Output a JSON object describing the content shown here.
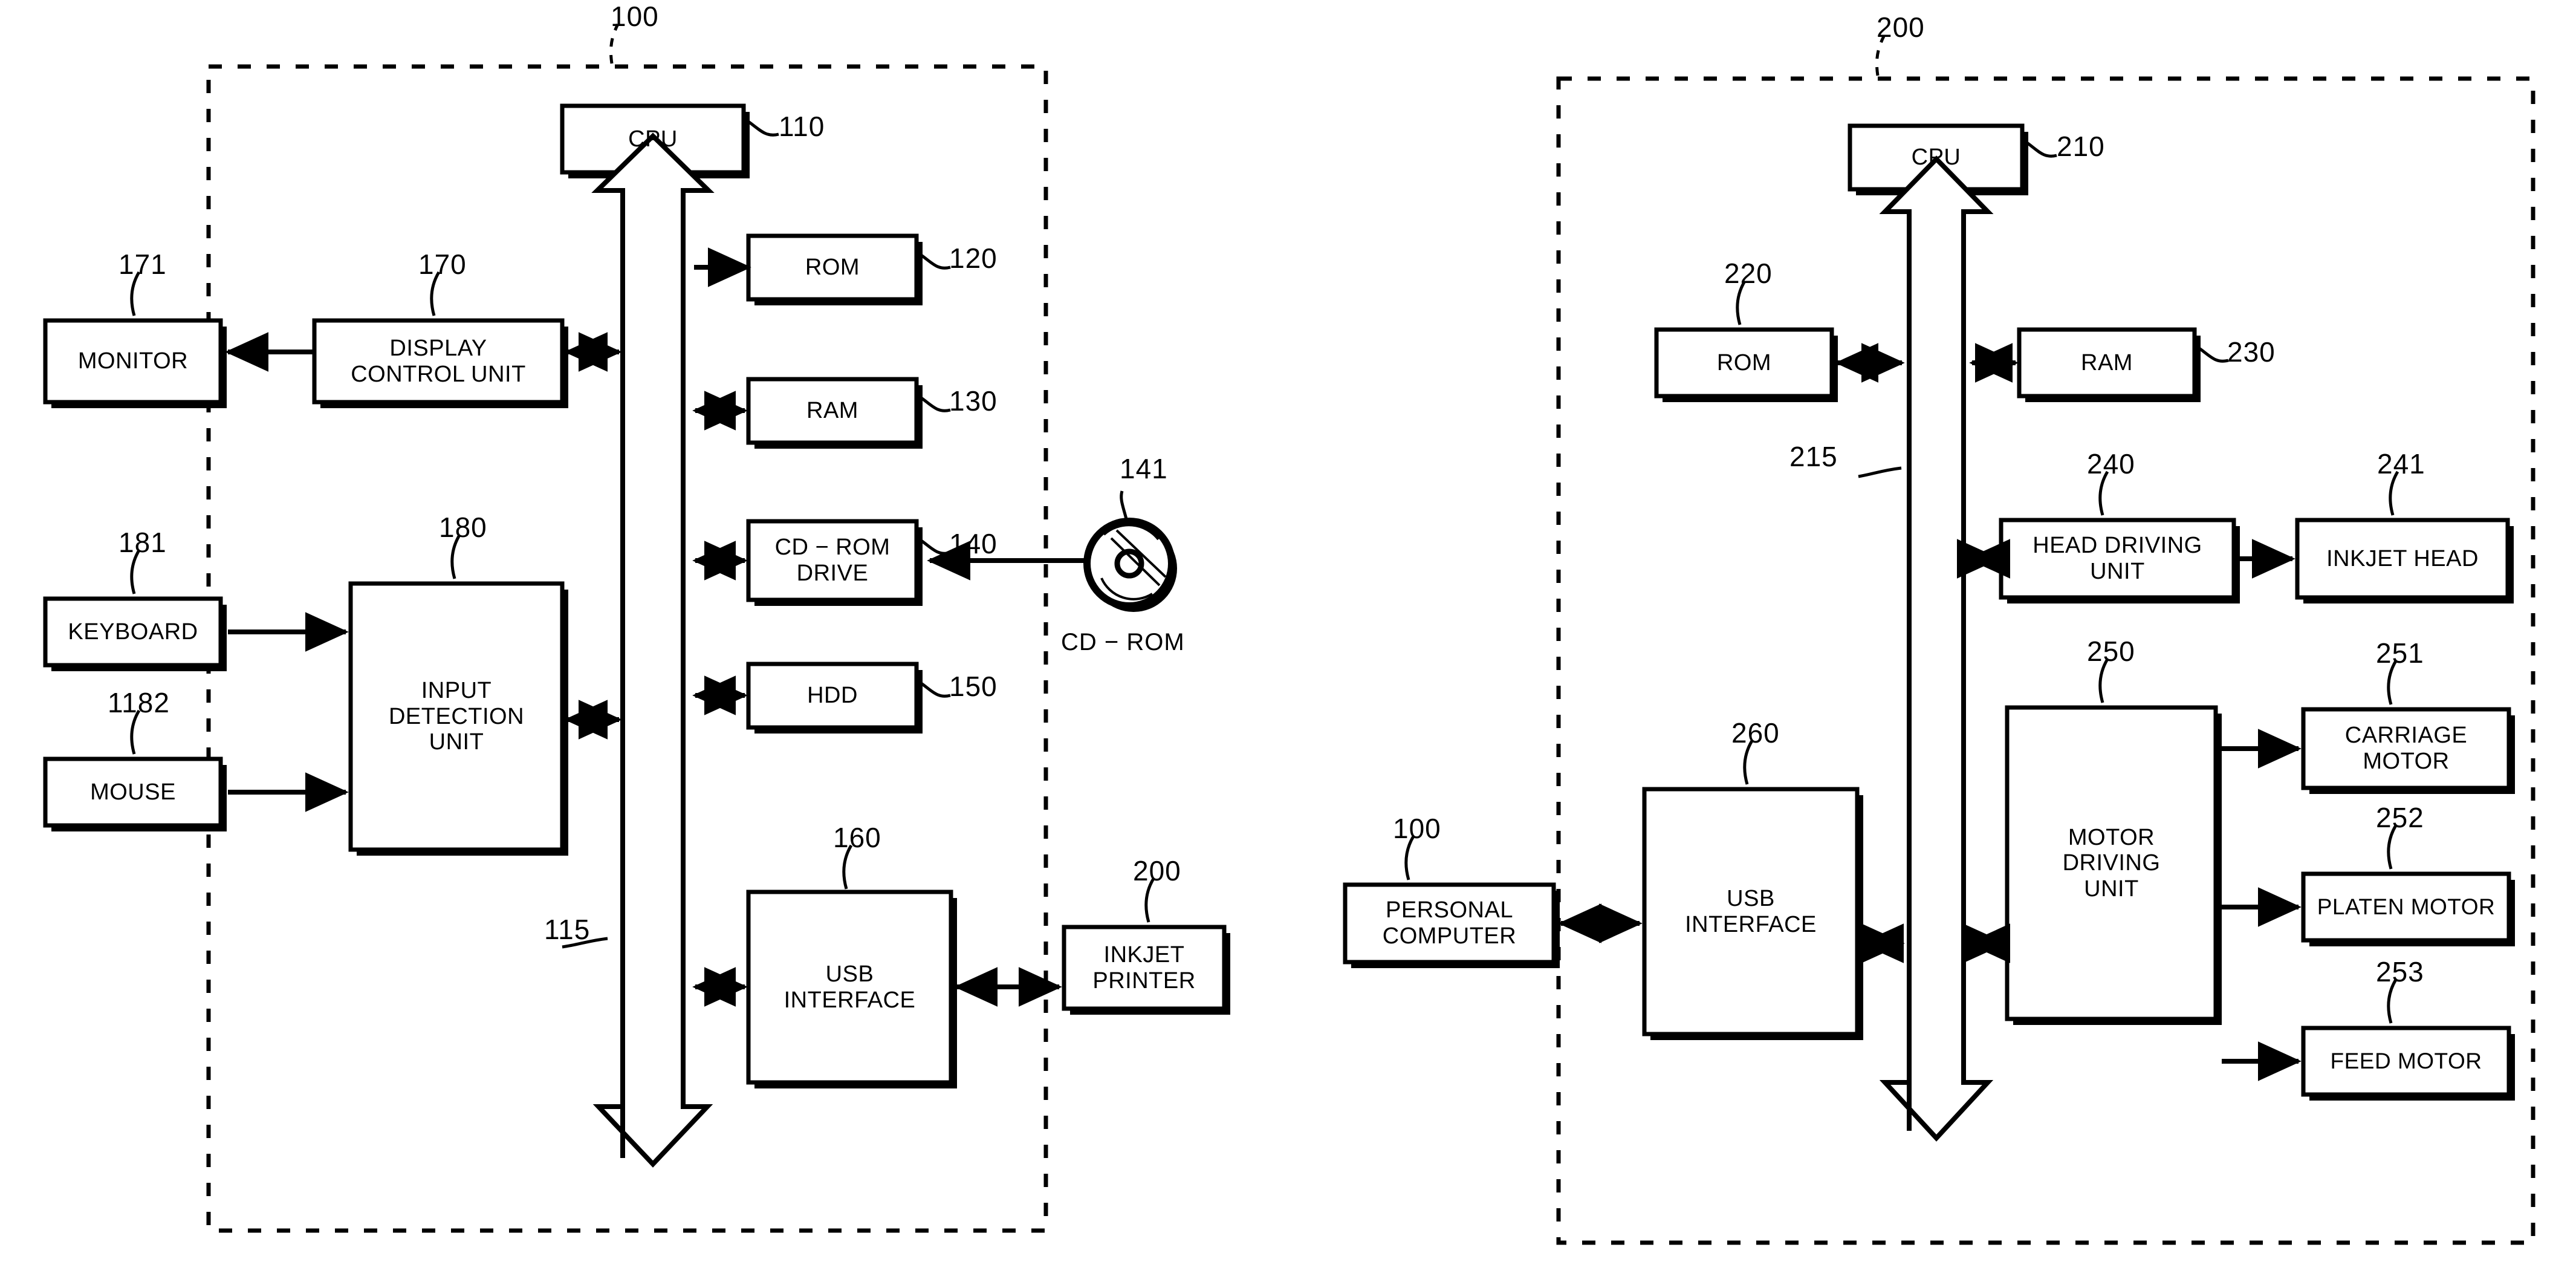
{
  "figure": {
    "type": "patent-block-diagram",
    "description": "Block diagram of a personal computer (100) connected to an inkjet printer (200)"
  },
  "panels": [
    {
      "id": "personal-computer",
      "ref": "100",
      "boundary": "dashed"
    },
    {
      "id": "inkjet-printer",
      "ref": "200",
      "boundary": "dashed"
    }
  ],
  "left_panel": {
    "ref_label": "100",
    "bus_label": "115",
    "blocks": {
      "cpu": {
        "label": "CPU",
        "ref": "110"
      },
      "rom": {
        "label": "ROM",
        "ref": "120"
      },
      "ram": {
        "label": "RAM",
        "ref": "130"
      },
      "cd_rom_drive": {
        "label": "CD − ROM\nDRIVE",
        "ref": "140"
      },
      "hdd": {
        "label": "HDD",
        "ref": "150"
      },
      "usb_interface": {
        "label": "USB\nINTERFACE",
        "ref": "160"
      },
      "display_control": {
        "label": "DISPLAY\nCONTROL UNIT",
        "ref": "170"
      },
      "monitor": {
        "label": "MONITOR",
        "ref": "171"
      },
      "input_detection": {
        "label": "INPUT\nDETECTION\nUNIT",
        "ref": "180"
      },
      "keyboard": {
        "label": "KEYBOARD",
        "ref": "181"
      },
      "mouse": {
        "label": "MOUSE",
        "ref": "1182"
      },
      "inkjet_printer": {
        "label": "INKJET\nPRINTER",
        "ref": "200"
      }
    },
    "cd_rom_media": {
      "caption": "CD − ROM",
      "ref": "141"
    }
  },
  "right_panel": {
    "ref_label": "200",
    "bus_label": "215",
    "blocks": {
      "cpu": {
        "label": "CPU",
        "ref": "210"
      },
      "rom": {
        "label": "ROM",
        "ref": "220"
      },
      "ram": {
        "label": "RAM",
        "ref": "230"
      },
      "head_driving": {
        "label": "HEAD DRIVING\nUNIT",
        "ref": "240"
      },
      "inkjet_head": {
        "label": "INKJET HEAD",
        "ref": "241"
      },
      "motor_driving": {
        "label": "MOTOR\nDRIVING\nUNIT",
        "ref": "250"
      },
      "carriage_motor": {
        "label": "CARRIAGE\nMOTOR",
        "ref": "251"
      },
      "platen_motor": {
        "label": "PLATEN MOTOR",
        "ref": "252"
      },
      "feed_motor": {
        "label": "FEED MOTOR",
        "ref": "253"
      },
      "usb_interface": {
        "label": "USB\nINTERFACE",
        "ref": "260"
      },
      "personal_computer": {
        "label": "PERSONAL\nCOMPUTER",
        "ref": "100"
      }
    }
  },
  "colors": {
    "line": "#000000",
    "background": "#ffffff"
  }
}
